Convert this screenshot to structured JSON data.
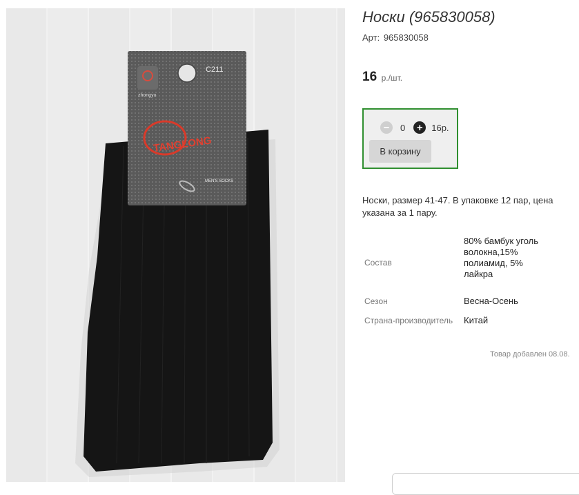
{
  "product": {
    "title": "Носки (965830058)",
    "art_label": "Арт:",
    "art_value": "965830058",
    "price_value": "16",
    "price_unit": "р./шт.",
    "photo_label": {
      "brand": "zhongyu",
      "code": "C211",
      "maker": "TANGLONG",
      "type": "MEN'S SOCKS"
    }
  },
  "cart": {
    "quantity": "0",
    "sum": "16р.",
    "button_label": "В корзину"
  },
  "description": "Носки, размер 41-47. В упаковке 12 пар, цена указана за 1 пару.",
  "specs": [
    {
      "label": "Состав",
      "value": "80% бамбук уголь волокна,15% полиамид, 5% лайкра"
    },
    {
      "label": "Сезон",
      "value": "Весна-Осень"
    },
    {
      "label": "Страна-производитель",
      "value": "Китай"
    }
  ],
  "added_text": "Товар добавлен 08.08.",
  "colors": {
    "accent_border": "#2f8f2f",
    "box_bg": "#efefef"
  }
}
